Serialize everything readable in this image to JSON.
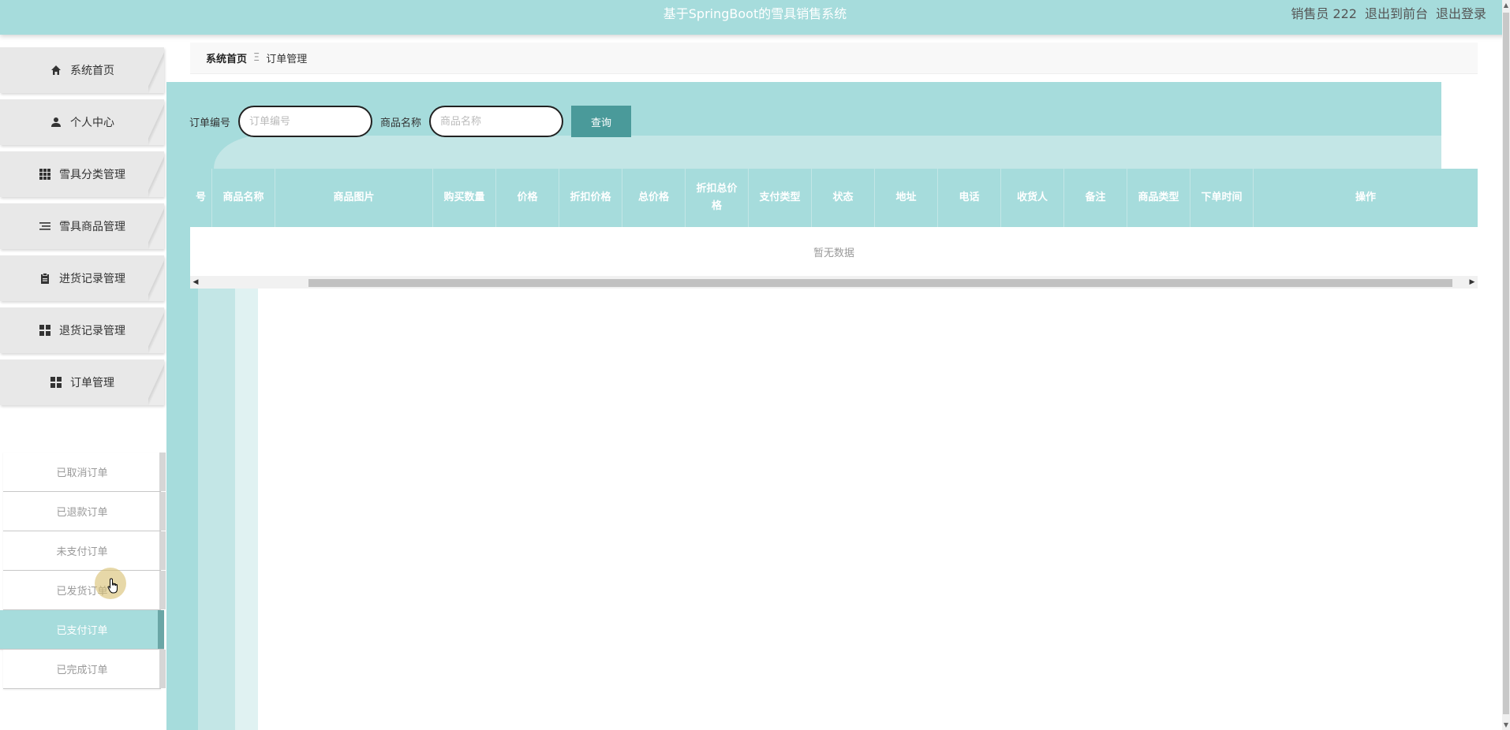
{
  "header": {
    "title": "基于SpringBoot的雪具销售系统",
    "user_label": "销售员 222",
    "back_to_front": "退出到前台",
    "logout": "退出登录"
  },
  "sidebar": {
    "items": [
      {
        "label": "系统首页",
        "icon": "home-icon"
      },
      {
        "label": "个人中心",
        "icon": "user-icon"
      },
      {
        "label": "雪具分类管理",
        "icon": "grid-icon"
      },
      {
        "label": "雪具商品管理",
        "icon": "list-icon"
      },
      {
        "label": "进货记录管理",
        "icon": "clipboard-icon"
      },
      {
        "label": "退货记录管理",
        "icon": "apps-icon"
      },
      {
        "label": "订单管理",
        "icon": "apps-icon"
      }
    ],
    "submenu": [
      {
        "label": "已取消订单",
        "active": false
      },
      {
        "label": "已退款订单",
        "active": false
      },
      {
        "label": "未支付订单",
        "active": false
      },
      {
        "label": "已发货订单",
        "active": false
      },
      {
        "label": "已支付订单",
        "active": true
      },
      {
        "label": "已完成订单",
        "active": false
      }
    ]
  },
  "breadcrumb": {
    "home": "系统首页",
    "separator": "Ξ",
    "current": "订单管理"
  },
  "search": {
    "order_no_label": "订单编号",
    "order_no_placeholder": "订单编号",
    "product_name_label": "商品名称",
    "product_name_placeholder": "商品名称",
    "query_button": "查询"
  },
  "table": {
    "columns": [
      "号",
      "商品名称",
      "商品图片",
      "购买数量",
      "价格",
      "折扣价格",
      "总价格",
      "折扣总价格",
      "支付类型",
      "状态",
      "地址",
      "电话",
      "收货人",
      "备注",
      "商品类型",
      "下单时间",
      "操作"
    ],
    "empty_text": "暂无数据"
  },
  "colors": {
    "accent": "#a6dcdc",
    "accent_light": "#c3e6e6",
    "button": "#4a9a9a"
  }
}
